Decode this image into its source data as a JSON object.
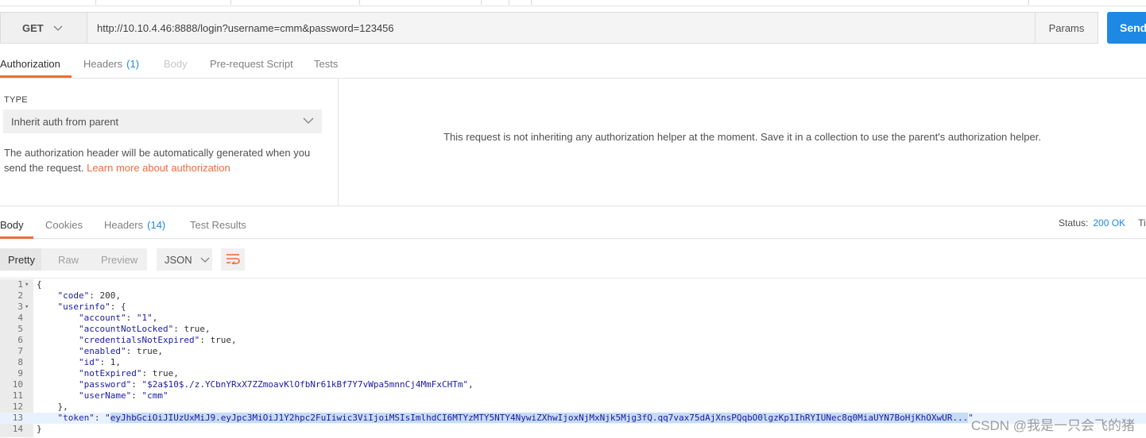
{
  "request": {
    "method": "GET",
    "url": "http://10.10.4.46:8888/login?username=cmm&password=123456",
    "params_label": "Params",
    "send_label": "Send"
  },
  "request_tabs": [
    {
      "label": "Authorization",
      "count": ""
    },
    {
      "label": "Headers",
      "count": "(1)"
    },
    {
      "label": "Body",
      "count": ""
    },
    {
      "label": "Pre-request Script",
      "count": ""
    },
    {
      "label": "Tests",
      "count": ""
    }
  ],
  "auth": {
    "type_label": "TYPE",
    "type_value": "Inherit auth from parent",
    "description": "The authorization header will be automatically generated when you send the request.",
    "learn_more": "Learn more about authorization",
    "message": "This request is not inheriting any authorization helper at the moment. Save it in a collection to use the parent's authorization helper."
  },
  "response_tabs": [
    {
      "label": "Body",
      "count": ""
    },
    {
      "label": "Cookies",
      "count": ""
    },
    {
      "label": "Headers",
      "count": "(14)"
    },
    {
      "label": "Test Results",
      "count": ""
    }
  ],
  "status": {
    "label": "Status:",
    "value": "200 OK",
    "time_label": "Tim"
  },
  "view": {
    "modes": [
      "Pretty",
      "Raw",
      "Preview"
    ],
    "format": "JSON"
  },
  "code_lines": [
    "{",
    "    \"code\": 200,",
    "    \"userinfo\": {",
    "        \"account\": \"1\",",
    "        \"accountNotLocked\": true,",
    "        \"credentialsNotExpired\": true,",
    "        \"enabled\": true,",
    "        \"id\": 1,",
    "        \"notExpired\": true,",
    "        \"password\": \"$2a$10$./z.YCbnYRxX7ZZmoavKlOfbNr61kBf7Y7vWpa5mnnCj4MmFxCHTm\",",
    "        \"userName\": \"cmm\"",
    "    },",
    "    \"token\": \"eyJhbGciOiJIUzUxMiJ9.eyJpc3MiOiJ1Y2hpc2FuIiwic3ViIjoiMSIsImlhdCI6MTYzMTY5NTY4NywiZXhwIjoxNjMxNjk5Mjg3fQ.qq7vax75dAjXnsPQqbO0lgzKp1IhRYIUNec8q0MiaUYN7BoHjKhOXwUR...\"",
    "}"
  ],
  "watermark": "CSDN @我是一只会飞的猪"
}
